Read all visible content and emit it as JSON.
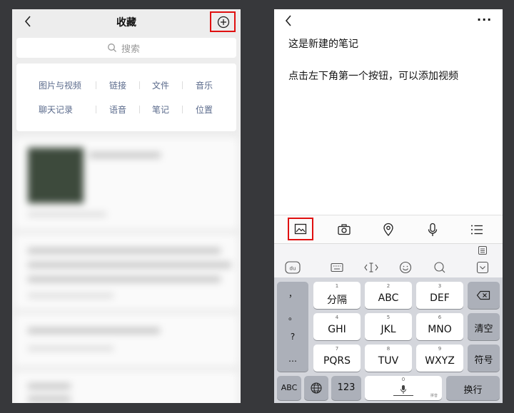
{
  "left": {
    "title": "收藏",
    "search_placeholder": "搜索",
    "categories": [
      "图片与视频",
      "链接",
      "文件",
      "音乐",
      "聊天记录",
      "语音",
      "笔记",
      "位置"
    ]
  },
  "right": {
    "note_line1": "这是新建的笔记",
    "note_line2": "点击左下角第一个按钮，可以添加视频",
    "more": "···",
    "toolbar_icons": [
      "image-icon",
      "camera-icon",
      "location-icon",
      "microphone-icon",
      "list-icon"
    ],
    "keyboard": {
      "punct": [
        "，",
        "。",
        "?",
        "…"
      ],
      "keys": [
        {
          "num": "1",
          "label": "分隔"
        },
        {
          "num": "2",
          "label": "ABC"
        },
        {
          "num": "3",
          "label": "DEF"
        },
        {
          "num": "4",
          "label": "GHI"
        },
        {
          "num": "5",
          "label": "JKL"
        },
        {
          "num": "6",
          "label": "MNO"
        },
        {
          "num": "7",
          "label": "PQRS"
        },
        {
          "num": "8",
          "label": "TUV"
        },
        {
          "num": "9",
          "label": "WXYZ"
        }
      ],
      "clear": "清空",
      "symbol": "符号",
      "abc": "ABC",
      "num123": "123",
      "space_num": "0",
      "space_hint": "拼音",
      "enter": "换行"
    }
  },
  "colors": {
    "highlight": "#e01010",
    "category_text": "#5b6b8c",
    "background": "#37383b"
  }
}
